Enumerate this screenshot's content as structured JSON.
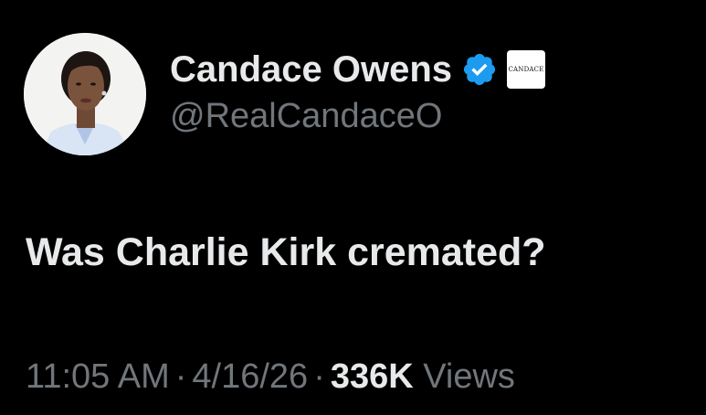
{
  "author": {
    "display_name": "Candace Owens",
    "handle": "@RealCandaceO",
    "affiliation_badge_text": "CANDACE",
    "verified_color": "#1d9bf0"
  },
  "tweet": {
    "text": "Was Charlie Kirk cremated?",
    "time": "11:05 AM",
    "separator": "·",
    "date": "4/16/26",
    "views_count": "336K",
    "views_label": "Views"
  },
  "colors": {
    "background": "#000000",
    "primary_text": "#e7e9ea",
    "secondary_text": "#71767b"
  }
}
